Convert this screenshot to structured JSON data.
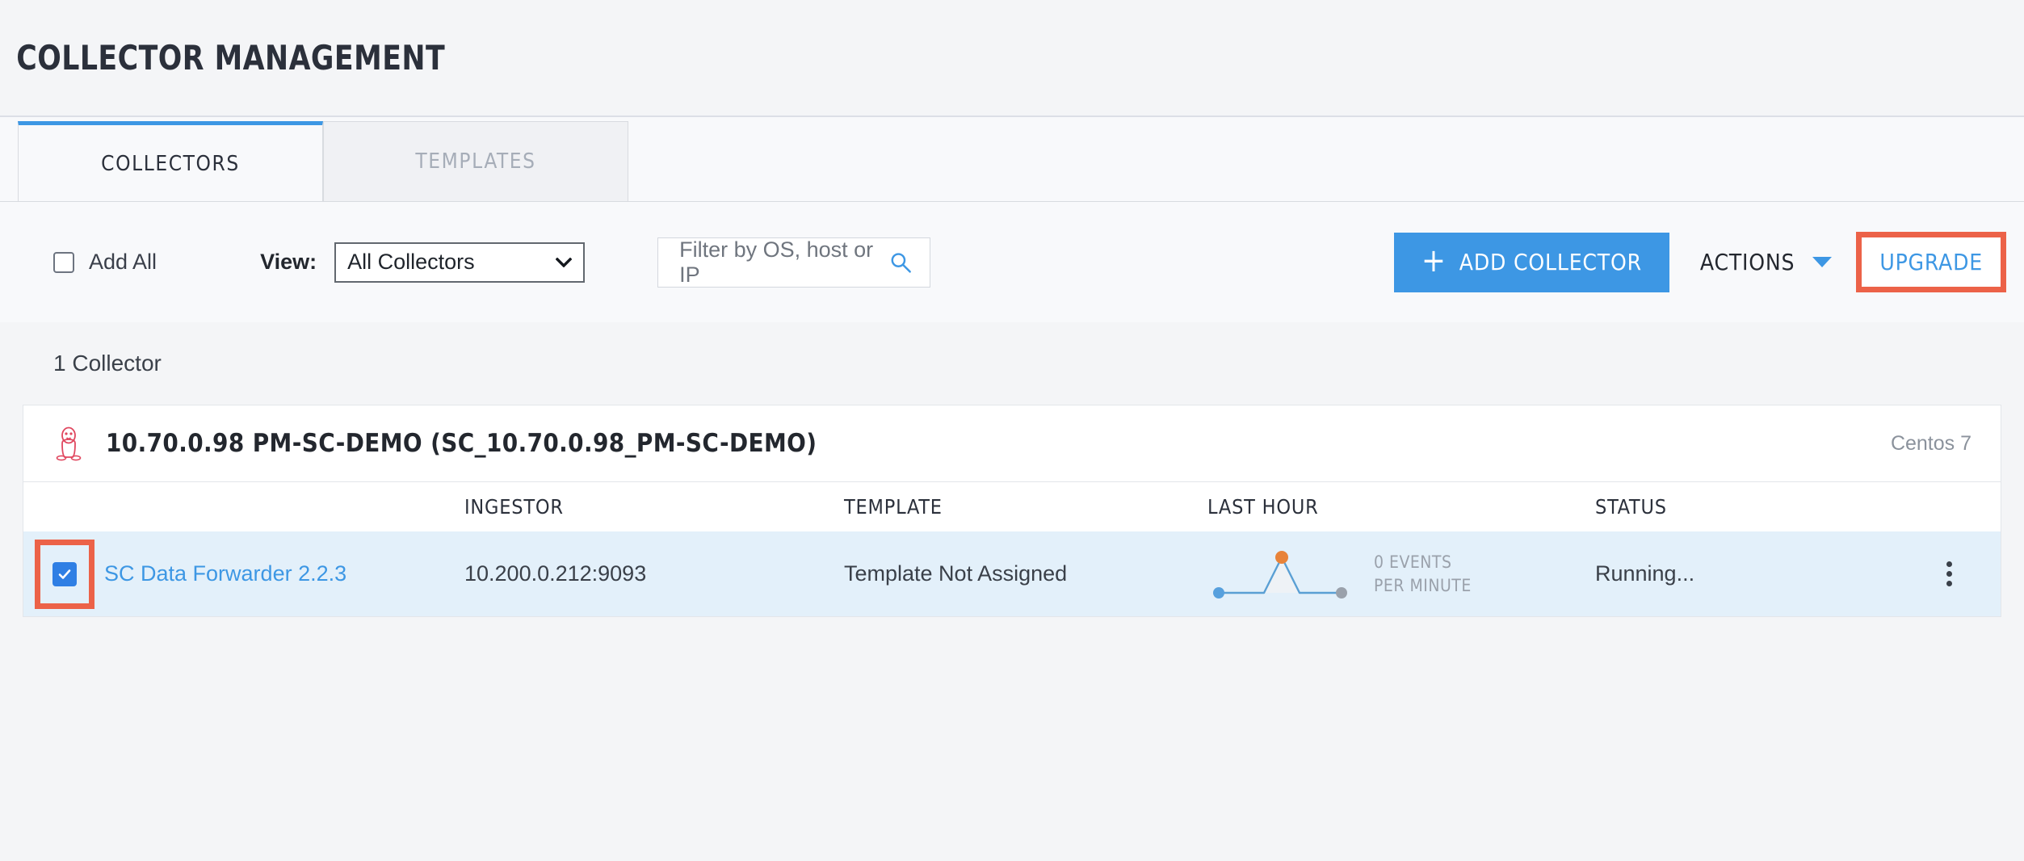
{
  "header": {
    "title": "COLLECTOR MANAGEMENT"
  },
  "tabs": [
    {
      "label": "COLLECTORS",
      "active": true
    },
    {
      "label": "TEMPLATES",
      "active": false
    }
  ],
  "toolbar": {
    "add_all_label": "Add All",
    "add_all_checked": false,
    "view_label": "View:",
    "view_selected": "All Collectors",
    "view_options": [
      "All Collectors"
    ],
    "search_placeholder": "Filter by OS, host or IP",
    "search_value": "",
    "search_icon": "search-icon",
    "add_collector_label": "ADD COLLECTOR",
    "add_collector_plus": "+",
    "actions_label": "ACTIONS",
    "upgrade_label": "UPGRADE"
  },
  "list": {
    "count_label": "1 Collector",
    "card": {
      "os_icon": "linux-tux-icon",
      "title": "10.70.0.98 PM-SC-DEMO (SC_10.70.0.98_PM-SC-DEMO)",
      "os": "Centos 7",
      "columns": [
        "INGESTOR",
        "TEMPLATE",
        "LAST HOUR",
        "STATUS"
      ],
      "rows": [
        {
          "selected": true,
          "name": "SC Data Forwarder 2.2.3",
          "ingestor": "10.200.0.212:9093",
          "template": "Template Not Assigned",
          "events_line1": "0 EVENTS",
          "events_line2": "PER MINUTE",
          "status": "Running..."
        }
      ]
    }
  },
  "chart_data": {
    "type": "line",
    "title": "Last hour events per minute sparkline",
    "x": [
      0,
      1,
      2,
      3
    ],
    "values": [
      0,
      0,
      10,
      0
    ],
    "point_colors": [
      "#57a0dd",
      "",
      "#e8833a",
      "#9aa1ab"
    ],
    "ylim": [
      0,
      10
    ],
    "grid": false,
    "annotations": [
      "0 EVENTS",
      "PER MINUTE"
    ]
  },
  "colors": {
    "accent_blue": "#3d97e4",
    "highlight_red": "#ec6248",
    "row_selected_bg": "#e3f0fa",
    "peak_orange": "#e8833a",
    "tux_pink": "#e0475f"
  }
}
